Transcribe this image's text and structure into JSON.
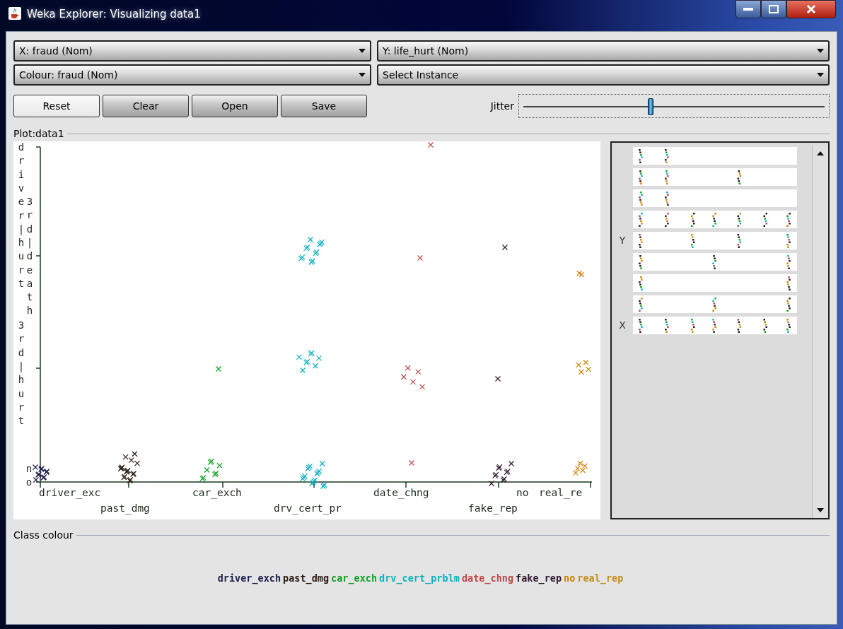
{
  "window": {
    "title": "Weka Explorer: Visualizing data1"
  },
  "selectors": [
    {
      "label": "X: fraud (Nom)"
    },
    {
      "label": "Y: life_hurt (Nom)"
    },
    {
      "label": "Colour: fraud (Nom)"
    },
    {
      "label": "Select Instance"
    }
  ],
  "buttons": [
    {
      "label": "Reset",
      "focused": true
    },
    {
      "label": "Clear",
      "focused": false
    },
    {
      "label": "Open",
      "focused": false
    },
    {
      "label": "Save",
      "focused": false
    }
  ],
  "jitter": {
    "label": "Jitter",
    "level": 0.42
  },
  "plot": {
    "title": "Plot:data1",
    "y_labels": [
      "driver|hurt",
      "3rd|death",
      "3rd|hurt",
      "no"
    ],
    "x_labels": [
      "driver_exc",
      "past_dmg",
      "car_exch",
      "drv_cert_pr",
      "date_chng",
      "fake_rep",
      "no",
      "real_re"
    ]
  },
  "matrix": {
    "y_label": "Y",
    "x_label": "X"
  },
  "class_colour": {
    "title": "Class colour",
    "classes": [
      {
        "label": "driver_exch",
        "color": "#1c1c4c"
      },
      {
        "label": "past_dmg",
        "color": "#2a1a10"
      },
      {
        "label": "car_exch",
        "color": "#10a020"
      },
      {
        "label": "drv_cert_prblm",
        "color": "#10b0c0"
      },
      {
        "label": "date_chng",
        "color": "#c04848"
      },
      {
        "label": "fake_rep",
        "color": "#301830"
      },
      {
        "label": "no",
        "color": "#d08000"
      },
      {
        "label": "real_rep",
        "color": "#c09020"
      }
    ]
  }
}
